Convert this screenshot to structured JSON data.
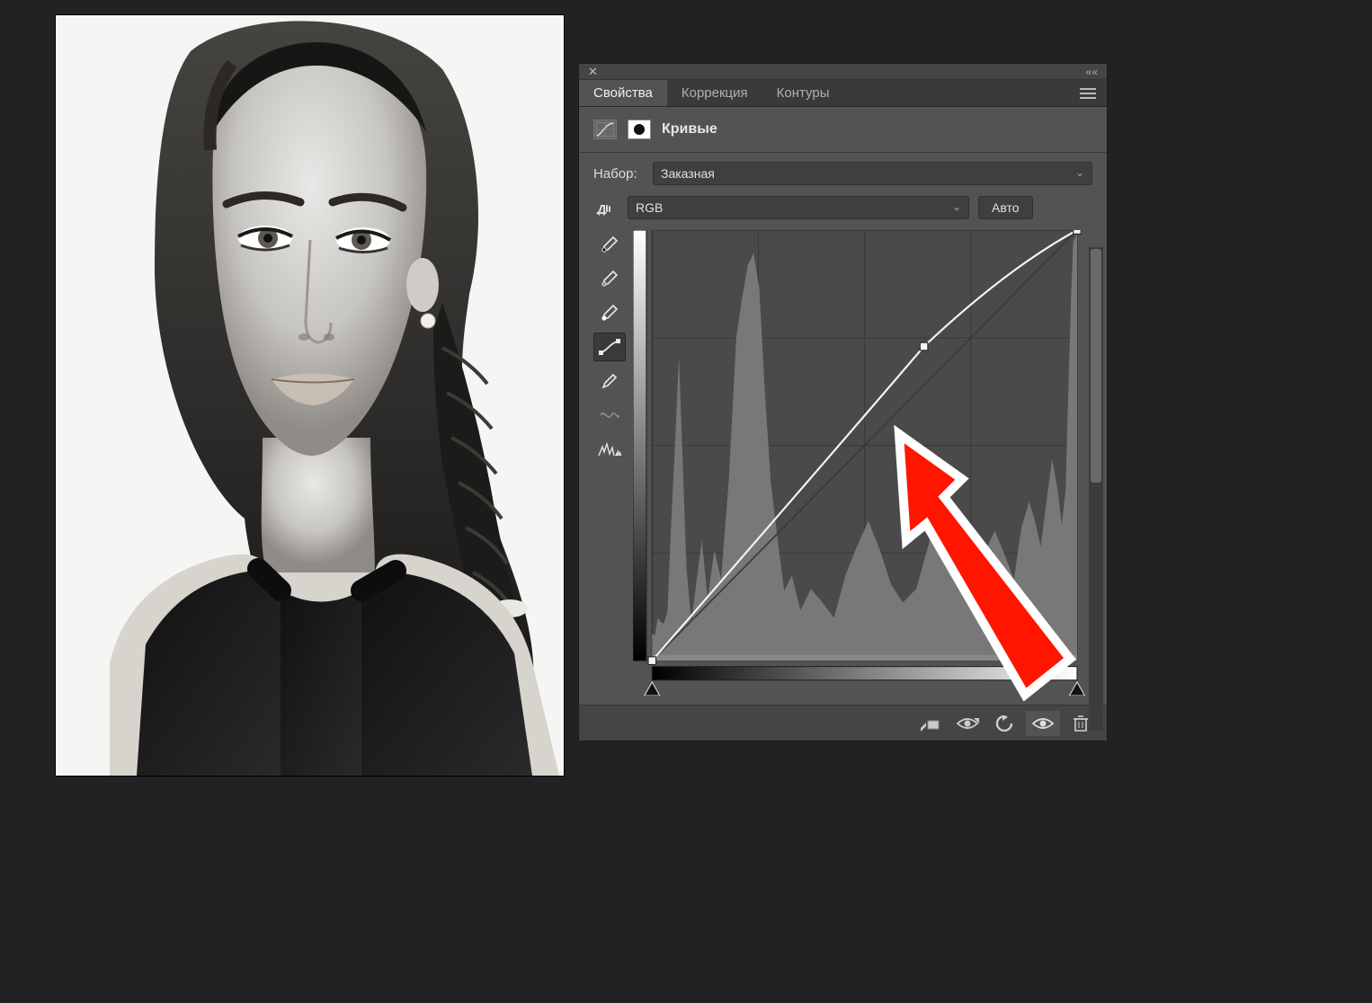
{
  "tabs": {
    "properties": "Свойства",
    "adjustments": "Коррекция",
    "paths": "Контуры"
  },
  "adjustment_title": "Кривые",
  "preset": {
    "label": "Набор:",
    "value": "Заказная"
  },
  "channel": {
    "value": "RGB",
    "auto": "Авто"
  },
  "tools": {
    "targeted": "targeted-adjustment",
    "eyedropper_black": "black-point-eyedropper",
    "eyedropper_gray": "gray-point-eyedropper",
    "eyedropper_white": "white-point-eyedropper",
    "curve_edit": "curve-point-edit",
    "pencil": "pencil",
    "smooth": "smooth",
    "clip_warning": "clip-warning"
  },
  "footer": {
    "clip": "clip-to-layer",
    "visibility_prev": "view-previous",
    "reset": "reset",
    "visibility": "visibility",
    "trash": "delete"
  },
  "curves": {
    "domain": [
      0,
      255
    ],
    "points": [
      {
        "input": 0,
        "output": 0
      },
      {
        "input": 163,
        "output": 186
      },
      {
        "input": 255,
        "output": 255
      }
    ]
  }
}
